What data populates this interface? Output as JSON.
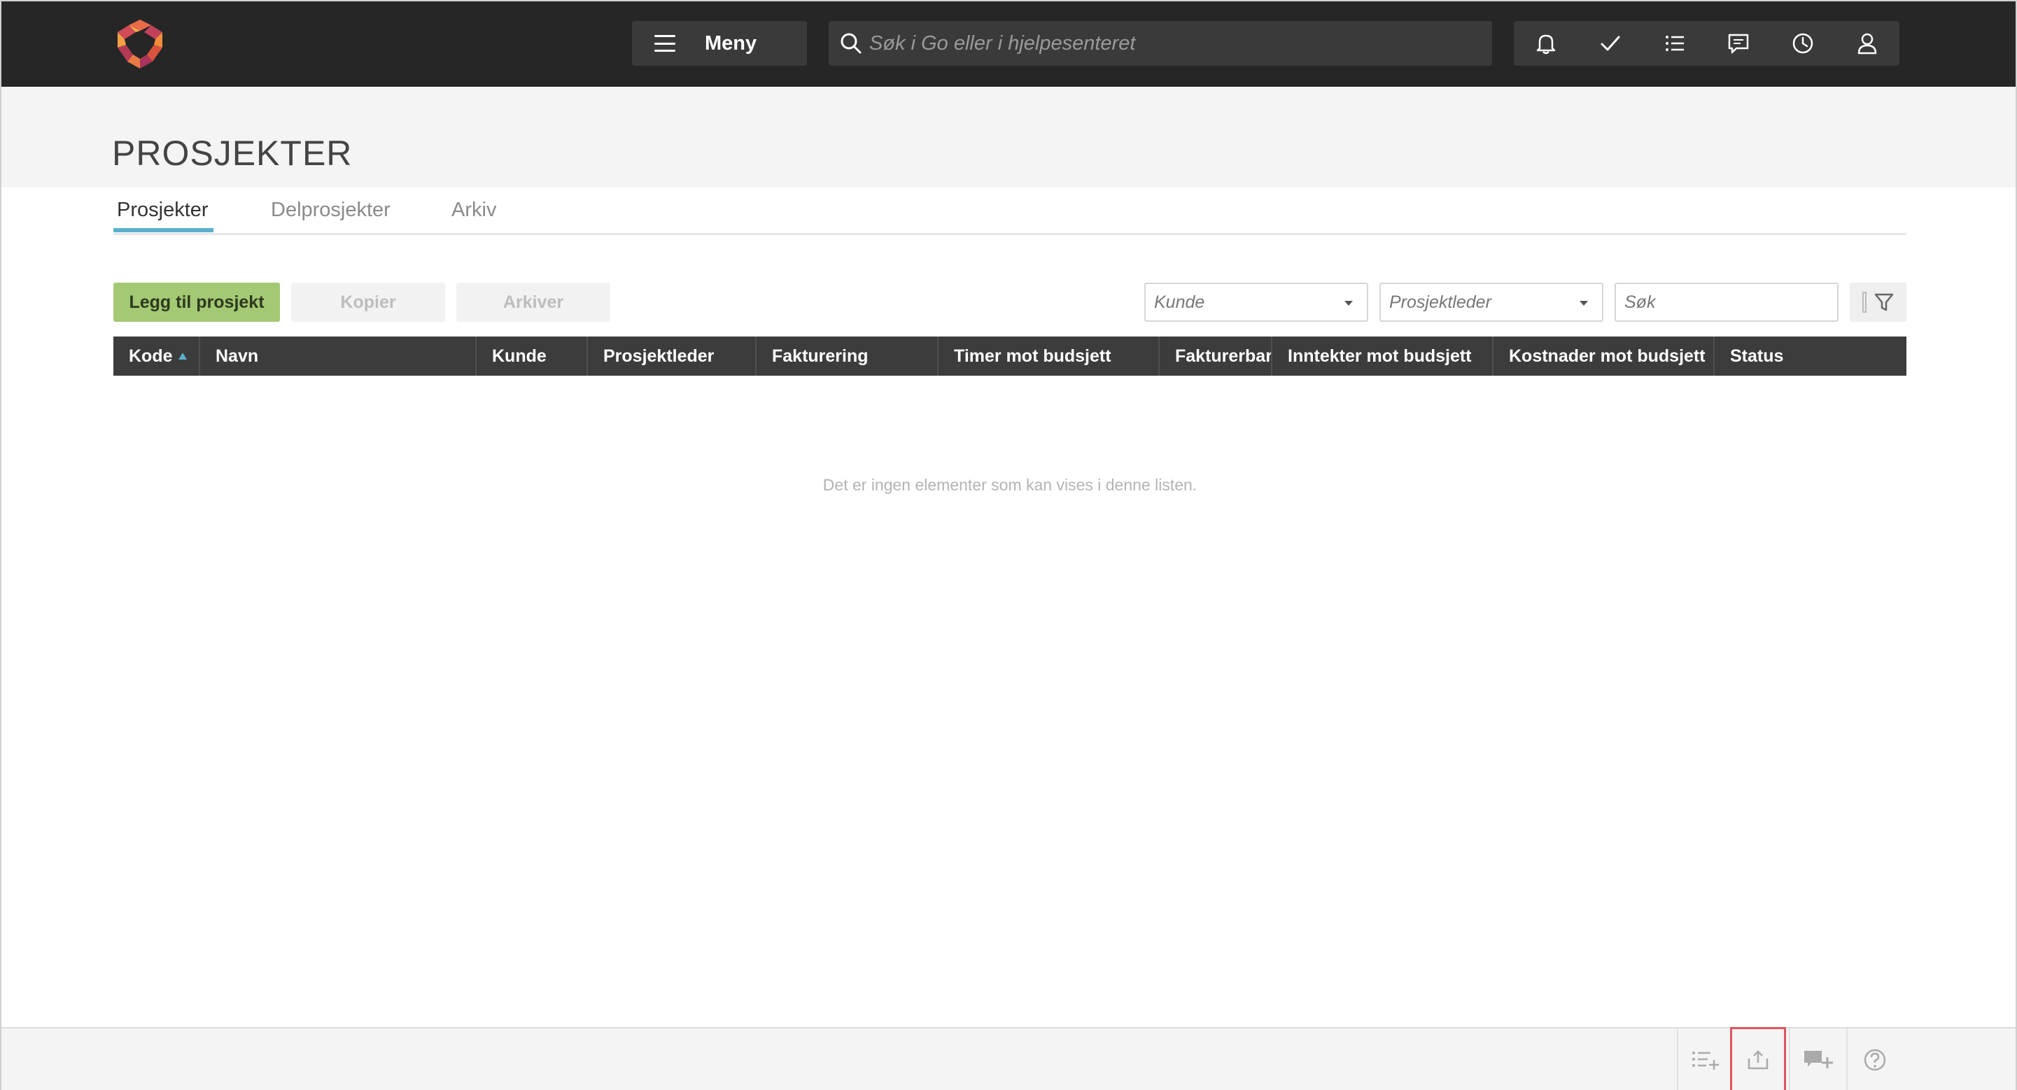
{
  "topbar": {
    "menu_label": "Meny",
    "search_placeholder": "Søk i Go eller i hjelpesenteret",
    "icons": [
      "bell-icon",
      "check-icon",
      "list-icon",
      "chat-icon",
      "clock-icon",
      "user-icon"
    ]
  },
  "page": {
    "title": "PROSJEKTER"
  },
  "tabs": [
    {
      "label": "Prosjekter",
      "active": true
    },
    {
      "label": "Delprosjekter",
      "active": false
    },
    {
      "label": "Arkiv",
      "active": false
    }
  ],
  "toolbar": {
    "add_label": "Legg til prosjekt",
    "copy_label": "Kopier",
    "archive_label": "Arkiver",
    "customer_placeholder": "Kunde",
    "manager_placeholder": "Prosjektleder",
    "search_placeholder": "Søk"
  },
  "table": {
    "columns": [
      "Kode",
      "Navn",
      "Kunde",
      "Prosjektleder",
      "Fakturering",
      "Timer mot budsjett",
      "Fakturerbar",
      "Inntekter mot budsjett",
      "Kostnader mot budsjett",
      "Status"
    ],
    "sort_column": "Kode",
    "sort_direction": "asc",
    "empty_message": "Det er ingen elementer som kan vises i denne listen."
  },
  "footer": {
    "icons": [
      "add-list-icon",
      "export-icon",
      "add-comment-icon",
      "help-icon"
    ],
    "highlighted": "export-icon"
  },
  "colors": {
    "topbar": "#262626",
    "primary_button": "#a4c974",
    "tab_accent": "#5ab0cc",
    "highlight": "#e0555f"
  }
}
